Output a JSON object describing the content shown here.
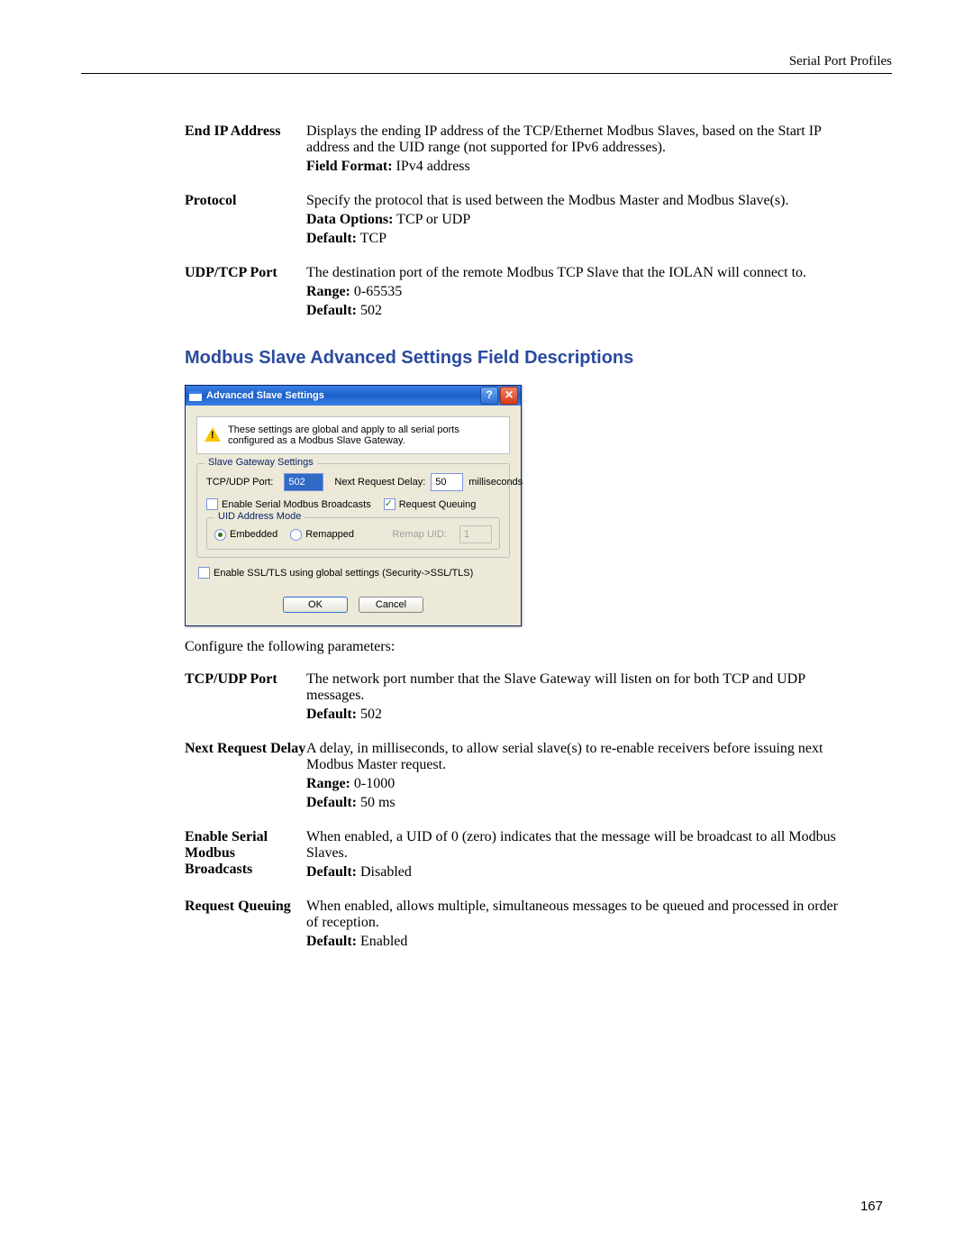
{
  "header": "Serial Port Profiles",
  "page_number": "167",
  "table1": [
    {
      "term": "End IP Address",
      "desc": "Displays the ending IP address of the TCP/Ethernet Modbus Slaves, based on the Start IP address and the UID range (not supported for IPv6 addresses).",
      "lines": [
        {
          "b": "Field Format:",
          "t": " IPv4 address"
        }
      ]
    },
    {
      "term": "Protocol",
      "desc": "Specify the protocol that is used between the Modbus Master and Modbus Slave(s).",
      "lines": [
        {
          "b": "Data Options:",
          "t": " TCP or UDP"
        },
        {
          "b": "Default:",
          "t": " TCP"
        }
      ]
    },
    {
      "term": "UDP/TCP Port",
      "desc": "The destination port of the remote Modbus TCP Slave that the IOLAN will connect to.",
      "lines": [
        {
          "b": "Range:",
          "t": " 0-65535"
        },
        {
          "b": "Default:",
          "t": " 502"
        }
      ]
    }
  ],
  "section_title": "Modbus Slave Advanced Settings Field Descriptions",
  "dialog": {
    "title": "Advanced Slave Settings",
    "info": "These settings are global and apply to all serial ports configured as a Modbus Slave Gateway.",
    "fieldset_title": "Slave Gateway Settings",
    "tcpudp_label": "TCP/UDP Port:",
    "tcpudp_value": "502",
    "nrd_label": "Next Request Delay:",
    "nrd_value": "50",
    "nrd_unit": "milliseconds",
    "broadcast_label": "Enable Serial Modbus Broadcasts",
    "queuing_label": "Request Queuing",
    "uid_mode_title": "UID Address Mode",
    "embedded": "Embedded",
    "remapped": "Remapped",
    "remap_uid_label": "Remap UID:",
    "remap_uid_value": "1",
    "ssl_label": "Enable SSL/TLS using global settings (Security->SSL/TLS)",
    "ok": "OK",
    "cancel": "Cancel"
  },
  "configure_text": "Configure the following parameters:",
  "table2": [
    {
      "term": "TCP/UDP Port",
      "desc": "The network port number that the Slave Gateway will listen on for both TCP and UDP messages.",
      "lines": [
        {
          "b": "Default:",
          "t": " 502"
        }
      ]
    },
    {
      "term": "Next Request Delay",
      "desc": "A delay, in milliseconds, to allow serial slave(s) to re-enable receivers before issuing next Modbus Master request.",
      "termtight": true,
      "lines": [
        {
          "b": "Range:",
          "t": " 0-1000"
        },
        {
          "b": "Default:",
          "t": " 50 ms"
        }
      ]
    },
    {
      "term": "Enable Serial Modbus Broadcasts",
      "term_two_line": true,
      "desc": "When enabled, a UID of 0 (zero) indicates that the message will be broadcast to all Modbus Slaves.",
      "lines": [
        {
          "b": "Default:",
          "t": " Disabled"
        }
      ]
    },
    {
      "term": "Request Queuing",
      "desc": "When enabled, allows multiple, simultaneous messages to be queued and processed in order of reception.",
      "lines": [
        {
          "b": "Default:",
          "t": " Enabled"
        }
      ]
    }
  ]
}
